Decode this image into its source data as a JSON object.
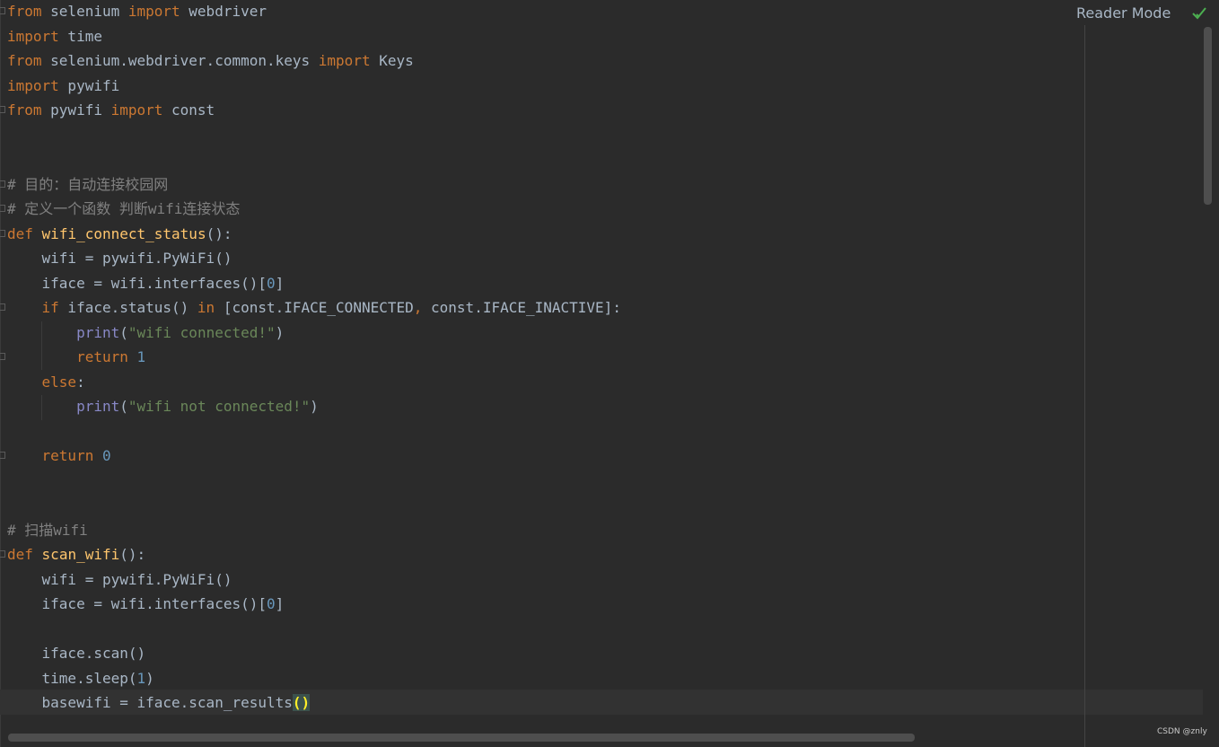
{
  "header": {
    "reader_mode_label": "Reader Mode",
    "status_icon": "checkmark-icon"
  },
  "watermark": "CSDN @znly",
  "colors": {
    "background": "#2b2b2b",
    "keyword": "#cc7832",
    "function_name": "#ffc66d",
    "string": "#6a8759",
    "number": "#6897bb",
    "comment": "#808080",
    "builtin": "#8888c6",
    "default_text": "#a9b7c6",
    "check": "#4caf50"
  },
  "code": {
    "l1": {
      "a": "from",
      "b": " selenium ",
      "c": "import",
      "d": " webdriver"
    },
    "l2": {
      "a": "import",
      "b": " time"
    },
    "l3": {
      "a": "from",
      "b": " selenium.webdriver.common.keys ",
      "c": "import",
      "d": " Keys"
    },
    "l4": {
      "a": "import",
      "b": " pywifi"
    },
    "l5": {
      "a": "from",
      "b": " pywifi ",
      "c": "import",
      "d": " const"
    },
    "l8": "# 目的：自动连接校园网",
    "l9": "# 定义一个函数 判断wifi连接状态",
    "l10": {
      "a": "def",
      "b": "wifi_connect_status",
      "c": "():"
    },
    "l11": "    wifi = pywifi.PyWiFi()",
    "l12": {
      "a": "    iface = wifi.interfaces()[",
      "b": "0",
      "c": "]"
    },
    "l13": {
      "a": "    ",
      "b": "if",
      "c": " iface.status() ",
      "d": "in",
      "e": " [const.IFACE_CONNECTED",
      "f": ",",
      "g": " const.IFACE_INACTIVE]:"
    },
    "l14": {
      "a": "        ",
      "b": "print",
      "c": "(",
      "d": "\"wifi connected!\"",
      "e": ")"
    },
    "l15": {
      "a": "        ",
      "b": "return",
      "c": " ",
      "d": "1"
    },
    "l16": {
      "a": "    ",
      "b": "else",
      "c": ":"
    },
    "l17": {
      "a": "        ",
      "b": "print",
      "c": "(",
      "d": "\"wifi not connected!\"",
      "e": ")"
    },
    "l19": {
      "a": "    ",
      "b": "return",
      "c": " ",
      "d": "0"
    },
    "l22": "# 扫描wifi",
    "l23": {
      "a": "def",
      "b": "scan_wifi",
      "c": "():"
    },
    "l24": "    wifi = pywifi.PyWiFi()",
    "l25": {
      "a": "    iface = wifi.interfaces()[",
      "b": "0",
      "c": "]"
    },
    "l27": "    iface.scan()",
    "l28": {
      "a": "    time.sleep(",
      "b": "1",
      "c": ")"
    },
    "l29": {
      "a": "    basewifi = iface.scan_results",
      "b": "()"
    }
  }
}
